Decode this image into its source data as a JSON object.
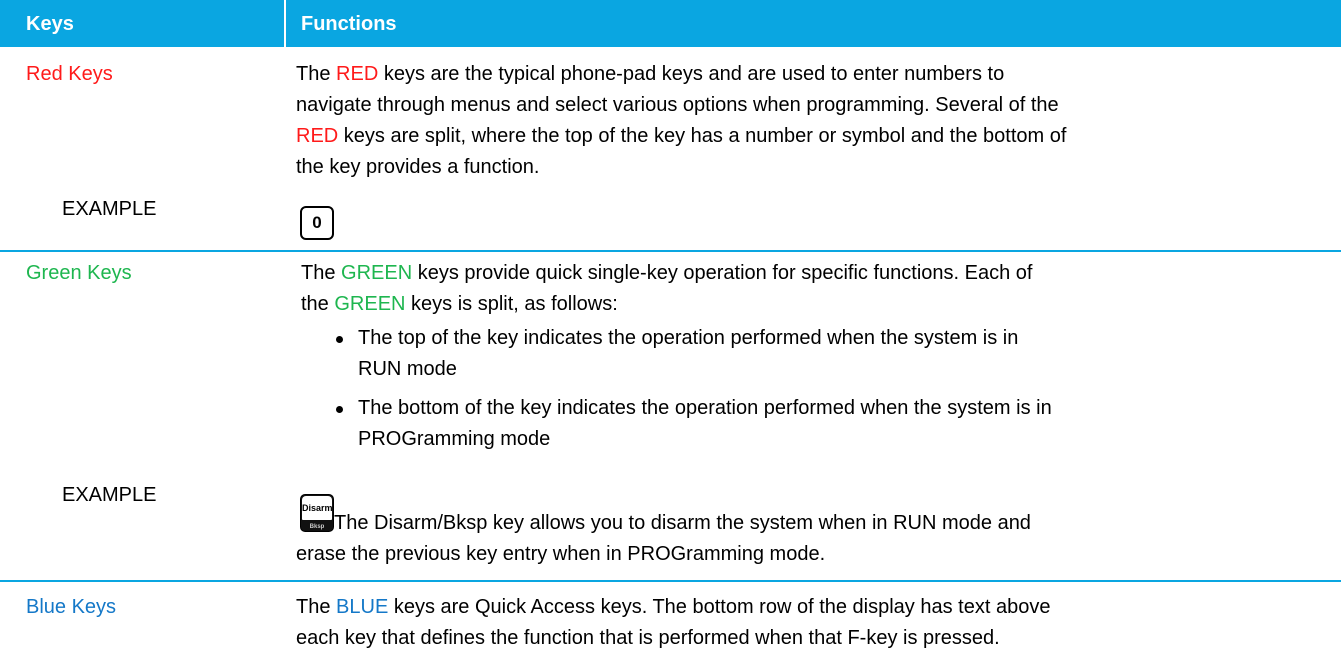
{
  "header": {
    "col1": "Keys",
    "col2": "Functions"
  },
  "colors": {
    "header_bg": "#0aa6e1",
    "red": "#ff1a1a",
    "green": "#1eb64f",
    "blue": "#1478c8"
  },
  "red": {
    "label": "Red Keys",
    "line1_a": "The ",
    "line1_word": "RED",
    "line1_b": " keys are the typical phone-pad keys and are used to enter numbers to",
    "line2": "navigate through menus and select various options when programming. Several of the",
    "line3_word": "RED",
    "line3_b": " keys are split, where the top of the key has a number or symbol and the bottom of",
    "line4": "the key provides a function.",
    "example_label": "EXAMPLE",
    "example_key": "0"
  },
  "green": {
    "label": "Green Keys",
    "line1_a": "The ",
    "line1_word": "GREEN",
    "line1_b": " keys provide quick single-key operation for specific functions. Each of",
    "line2_a": "the ",
    "line2_word": "GREEN",
    "line2_b": " keys is split, as follows:",
    "bullets": [
      {
        "l1": "The top of the key indicates the operation performed when the system is in",
        "l2": "RUN mode"
      },
      {
        "l1": "The bottom of the key indicates the operation performed when the system is in",
        "l2": "PROGramming mode"
      }
    ],
    "example_label": "EXAMPLE",
    "example_key_top": "Disarm",
    "example_key_bottom": "Bksp",
    "example_l1": " The Disarm/Bksp key allows you to disarm the system when in RUN mode and",
    "example_l2": "erase the previous key entry when in PROGramming mode."
  },
  "blue": {
    "label": "Blue Keys",
    "line1_a": "The ",
    "line1_word": "BLUE",
    "line1_b": " keys are Quick Access keys. The bottom row of the display has text above",
    "line2": "each key that defines the function that is performed when that F-key is pressed."
  }
}
